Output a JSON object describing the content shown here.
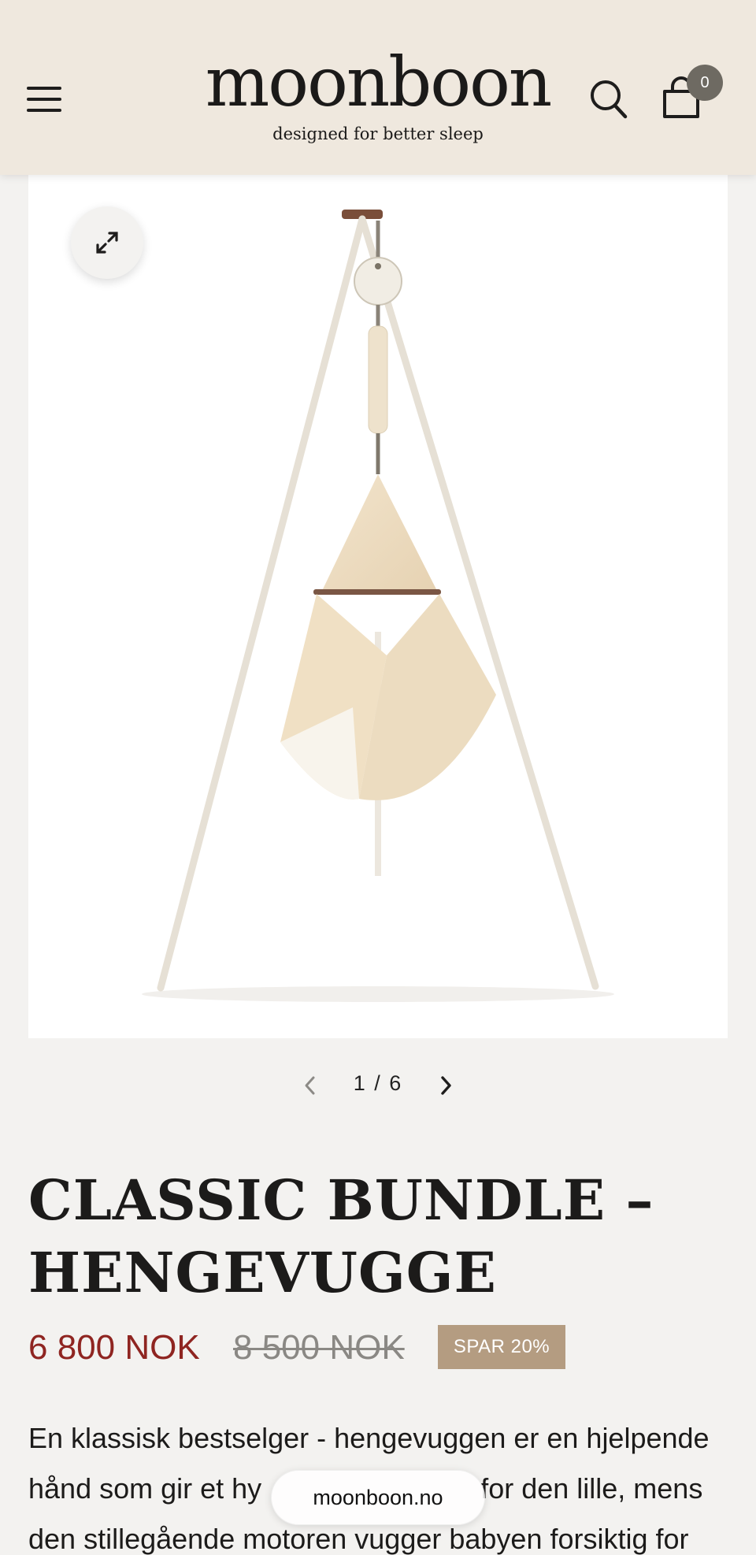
{
  "header": {
    "logo_word": "moonboon",
    "tagline": "designed for better sleep",
    "cart_count": "0",
    "icons": [
      "menu-icon",
      "search-icon",
      "cart-icon"
    ]
  },
  "gallery": {
    "expand_icon": "expand-icon",
    "current_index": "1",
    "total": "6",
    "pager_text": "1 / 6",
    "prev_icon": "chevron-left-icon",
    "next_icon": "chevron-right-icon"
  },
  "product": {
    "title_line1": "CLASSIC BUNDLE –",
    "title_line2": "HENGEVUGGE",
    "price_sale": "6 800 NOK",
    "price_original": "8 500 NOK",
    "save_badge": "SPAR 20%",
    "description_lines": [
      "En klassisk bestselger - hengevuggen er en hjelpende",
      "hånd som gir et hy",
      "for den lille, mens",
      "den stillegående motoren vugger babyen forsiktig for"
    ]
  },
  "browser": {
    "domain": "moonboon.no"
  },
  "colors": {
    "header_bg": "#efe8de",
    "page_bg": "#f3f2f0",
    "sale_price": "#8f2521",
    "badge_bg": "#b49c81",
    "cart_badge_bg": "#6e6a62"
  }
}
